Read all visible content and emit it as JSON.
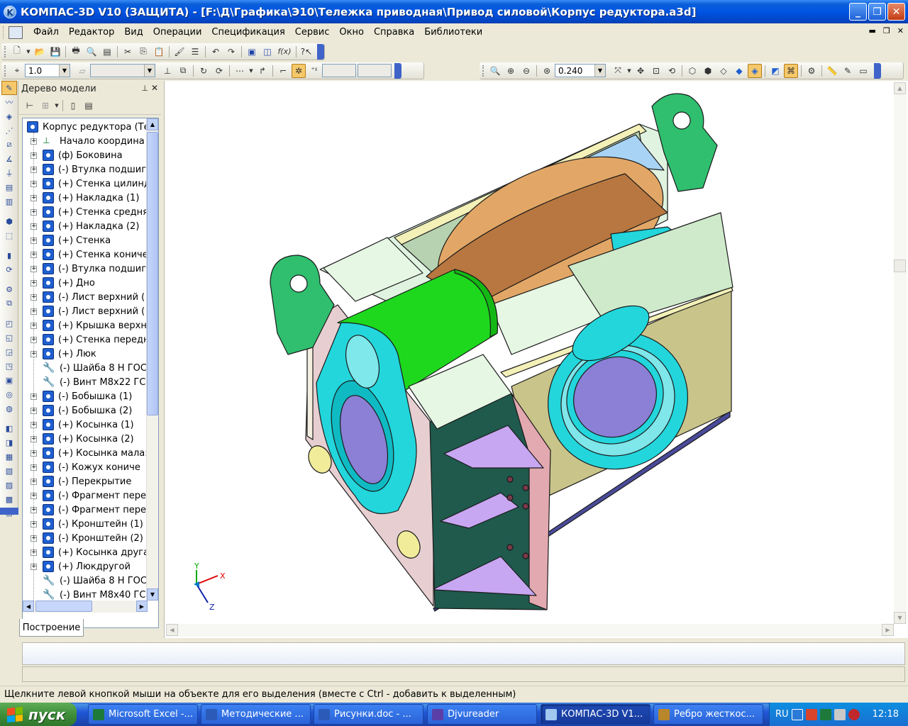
{
  "window": {
    "title": "КОМПАС-3D V10 (ЗАЩИТА) - [F:\\Д\\Графика\\Э10\\Тележка приводная\\Привод силовой\\Корпус редуктора.a3d]",
    "app_icon": "K"
  },
  "menu": {
    "items": [
      "Файл",
      "Редактор",
      "Вид",
      "Операции",
      "Спецификация",
      "Сервис",
      "Окно",
      "Справка",
      "Библиотеки"
    ]
  },
  "toolbar": {
    "step_value": "1.0",
    "zoom_value": "0.240",
    "fx_label": "f(x)"
  },
  "tree": {
    "title": "Дерево модели",
    "root": "Корпус редуктора (Те",
    "items": [
      {
        "label": "Начало координа",
        "type": "axis"
      },
      {
        "label": "(ф) Боковина",
        "type": "part"
      },
      {
        "label": "(-) Втулка подшиг",
        "type": "part"
      },
      {
        "label": "(+) Стенка цилинд",
        "type": "part"
      },
      {
        "label": "(+) Накладка (1)",
        "type": "part"
      },
      {
        "label": "(+) Стенка средня",
        "type": "part"
      },
      {
        "label": "(+) Накладка (2)",
        "type": "part"
      },
      {
        "label": "(+) Стенка",
        "type": "part"
      },
      {
        "label": "(+) Стенка кониче",
        "type": "part"
      },
      {
        "label": "(-) Втулка подшиг",
        "type": "part"
      },
      {
        "label": "(+) Дно",
        "type": "part"
      },
      {
        "label": "(-) Лист верхний (",
        "type": "part"
      },
      {
        "label": "(-) Лист верхний (",
        "type": "part"
      },
      {
        "label": "(+) Крышка верхн",
        "type": "part"
      },
      {
        "label": "(+) Стенка передн",
        "type": "part"
      },
      {
        "label": "(+) Люк",
        "type": "part"
      },
      {
        "label": "(-) Шайба 8 Н ГОС",
        "type": "bolt"
      },
      {
        "label": "(-) Винт М8х22 ГС",
        "type": "bolt"
      },
      {
        "label": "(-) Бобышка (1)",
        "type": "part"
      },
      {
        "label": "(-) Бобышка (2)",
        "type": "part"
      },
      {
        "label": "(+) Косынка (1)",
        "type": "part"
      },
      {
        "label": "(+) Косынка (2)",
        "type": "part"
      },
      {
        "label": "(+) Косынка мала:",
        "type": "part"
      },
      {
        "label": "(-) Кожух кониче",
        "type": "part"
      },
      {
        "label": "(-) Перекрытие",
        "type": "part"
      },
      {
        "label": "(-) Фрагмент пере",
        "type": "part"
      },
      {
        "label": "(-) Фрагмент пере",
        "type": "part"
      },
      {
        "label": "(-) Кронштейн (1)",
        "type": "part"
      },
      {
        "label": "(-) Кронштейн (2)",
        "type": "part"
      },
      {
        "label": "(+) Косынка друга",
        "type": "part"
      },
      {
        "label": "(+) Люкдругой",
        "type": "part"
      },
      {
        "label": "(-) Шайба 8 Н ГОС",
        "type": "bolt"
      },
      {
        "label": "(-) Винт М8х40 ГС",
        "type": "bolt"
      }
    ],
    "tab_label": "Построение"
  },
  "axes_gizmo": {
    "x": "X",
    "y": "Y",
    "z": "Z"
  },
  "status": {
    "hint": "Щелкните левой кнопкой мыши на объекте для его выделения (вместе с Ctrl - добавить к выделенным)"
  },
  "taskbar": {
    "start_label": "пуск",
    "tasks": [
      {
        "label": "Microsoft Excel -...",
        "color": "#1d7a3a"
      },
      {
        "label": "Методические ...",
        "color": "#2b5bb8"
      },
      {
        "label": "Рисунки.doc - ...",
        "color": "#2b5bb8"
      },
      {
        "label": "Djvureader",
        "color": "#5b3fa8"
      },
      {
        "label": "КОМПАС-3D V1...",
        "color": "#9fc7f0"
      },
      {
        "label": "Ребро жесткос...",
        "color": "#b8862b"
      }
    ],
    "lang": "RU",
    "clock": "12:18"
  },
  "colors": {
    "titlebar": "#0054e3",
    "active_tool": "#f5c86a",
    "model_green": "#1ed81e",
    "model_cyan": "#22d6dc"
  }
}
